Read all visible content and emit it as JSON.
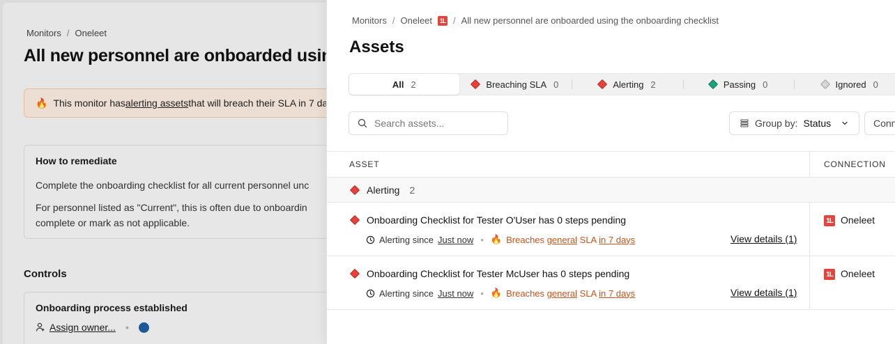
{
  "background": {
    "breadcrumb": [
      "Monitors",
      "Oneleet"
    ],
    "title": "All new personnel are onboarded using",
    "alert": {
      "prefix": "This monitor has ",
      "link": "alerting assets",
      "suffix": " that will breach their SLA in 7 da"
    },
    "remediate": {
      "heading": "How to remediate",
      "p1": "Complete the onboarding checklist for all current personnel unc",
      "p2a": "For personnel listed as \"Current\", this is often due to onboardin",
      "p2b": "complete or mark as not applicable."
    },
    "controls_heading": "Controls",
    "control": {
      "title": "Onboarding process established",
      "assign_owner": "Assign owner..."
    }
  },
  "drawer": {
    "breadcrumb": {
      "monitors": "Monitors",
      "oneleet": "Oneleet",
      "monitor": "All new personnel are onboarded using the onboarding checklist"
    },
    "title": "Assets",
    "logo_text": "1L",
    "tabs": [
      {
        "label": "All",
        "count": "2"
      },
      {
        "label": "Breaching SLA",
        "count": "0"
      },
      {
        "label": "Alerting",
        "count": "2"
      },
      {
        "label": "Passing",
        "count": "0"
      },
      {
        "label": "Ignored",
        "count": "0"
      }
    ],
    "search_placeholder": "Search assets...",
    "group_by": {
      "label": "Group by:",
      "value": "Status"
    },
    "connection_button": "Conn",
    "table": {
      "col_asset": "ASSET",
      "col_connection": "CONNECTION",
      "group": {
        "label": "Alerting",
        "count": "2"
      },
      "rows": [
        {
          "name": "Onboarding Checklist for Tester O'User has 0 steps pending",
          "alerting_since": "Alerting since",
          "since_value": "Just now",
          "breaches": "Breaches",
          "sla_name": "general",
          "sla": "SLA",
          "sla_due": "in 7 days",
          "view_details": "View details (1)",
          "connection": "Oneleet"
        },
        {
          "name": "Onboarding Checklist for Tester McUser has 0 steps pending",
          "alerting_since": "Alerting since",
          "since_value": "Just now",
          "breaches": "Breaches",
          "sla_name": "general",
          "sla": "SLA",
          "sla_due": "in 7 days",
          "view_details": "View details (1)",
          "connection": "Oneleet"
        }
      ]
    }
  },
  "colors": {
    "alert_red": "#e8413a",
    "passing_green": "#1aa37a",
    "breach_orange": "#c8531c"
  }
}
